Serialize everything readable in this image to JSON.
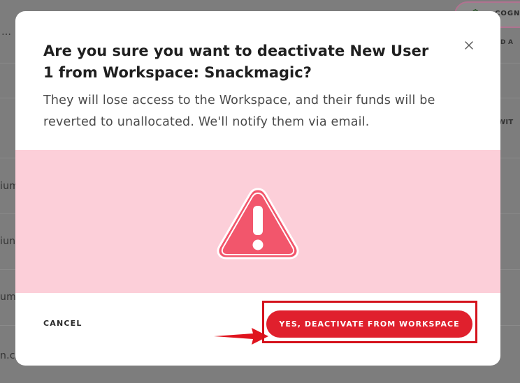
{
  "background": {
    "fragments": [
      "…",
      "D A",
      "D WIT",
      "ium",
      "iun",
      "um.",
      "n.co"
    ],
    "pill_text": "COGN"
  },
  "modal": {
    "title": "Are you sure you want to deactivate New User 1 from Workspace: Snackmagic?",
    "body": "They will lose access to the Workspace, and their funds will be reverted to unallocated. We'll notify them via email.",
    "close_icon": "close-icon",
    "warning_icon": "warning-triangle-icon",
    "cancel_label": "CANCEL",
    "confirm_label": "YES, DEACTIVATE FROM WORKSPACE"
  },
  "colors": {
    "overlay": "#7d7d7d",
    "warning_band": "#fccfd9",
    "warning_icon": "#f2566c",
    "confirm_button": "#e0202d",
    "annotation_red": "#d4121c"
  }
}
